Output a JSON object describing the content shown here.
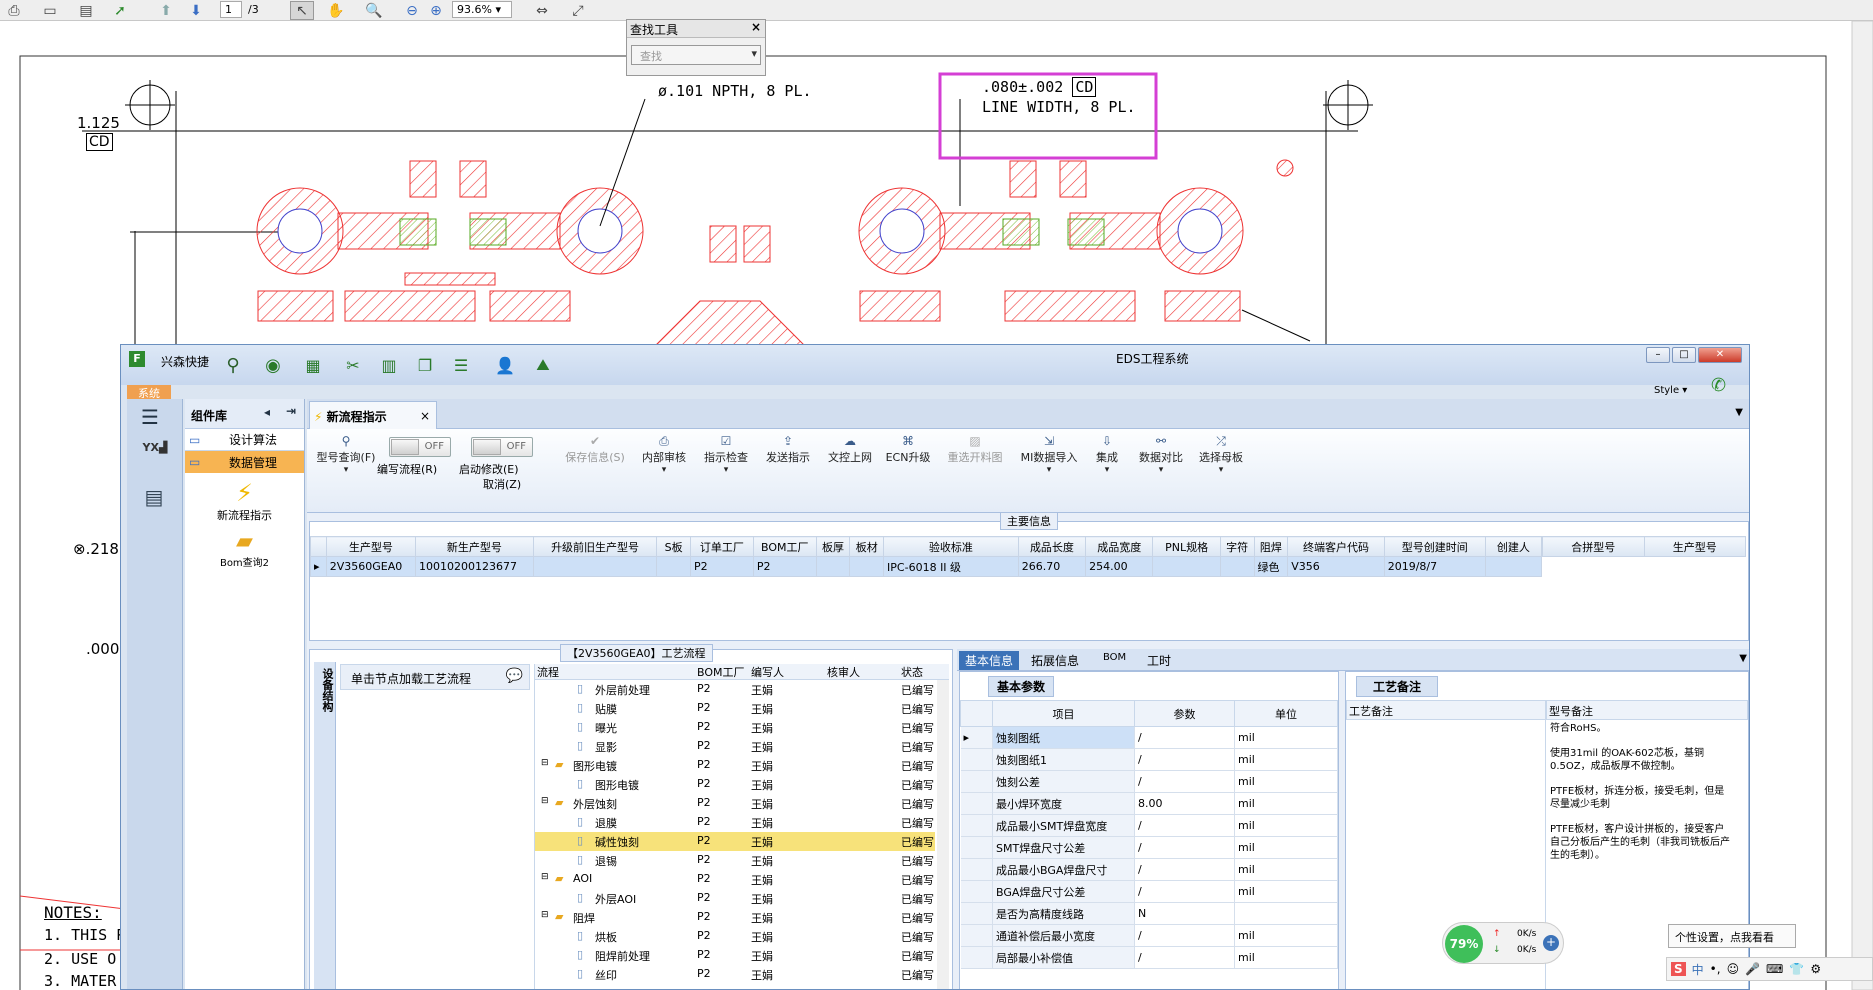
{
  "pdf": {
    "page_current": "1",
    "page_total": "/3",
    "zoom": "93.6%",
    "find_title": "查找工具",
    "find_placeholder": "查找",
    "drawing": {
      "npth": "ø.101 NPTH, 8 PL.",
      "linewidth_1": ".080±.002",
      "linewidth_cd": "CD",
      "linewidth_2": "LINE WIDTH, 8 PL.",
      "dim_1125": "1.125",
      "cd_left": "CD",
      "dim_218": "⊗.218",
      "dim_000": ".000",
      "notes": "NOTES:",
      "note1": "1. THIS P",
      "note2": "2. USE O",
      "note3": "3. MATER"
    }
  },
  "eds": {
    "app_name": "兴森快捷",
    "title": "EDS工程系统",
    "style_label": "Style",
    "system_tab": "系统",
    "library_title": "组件库",
    "library_items": [
      "设计算法",
      "数据管理"
    ],
    "new_process_label": "新流程指示",
    "bom_query_label": "Bom查询2",
    "doc_tab": "新流程指示",
    "ribbon": {
      "type_query": "型号查询(F)",
      "write_flow": "编写流程(R)",
      "start_edit": "启动修改(E)",
      "cancel": "取消(Z)",
      "off1": "OFF",
      "off2": "OFF",
      "save_info": "保存信息(S)",
      "internal_review": "内部审核",
      "instruction_check": "指示检查",
      "send_instruction": "发送指示",
      "doc_upload": "文控上网",
      "ecn_upgrade": "ECN升级",
      "reselect_drawing": "重选开料图",
      "mi_import": "MI数据导入",
      "integrate": "集成",
      "data_compare": "数据对比",
      "select_mother": "选择母板"
    },
    "main_info": {
      "title": "主要信息",
      "headers": [
        "生产型号",
        "新生产型号",
        "升级前旧生产型号",
        "S板",
        "订单工厂",
        "BOM工厂",
        "板厚",
        "板材",
        "验收标准",
        "成品长度",
        "成品宽度",
        "PNL规格",
        "字符",
        "阻焊",
        "终端客户代码",
        "型号创建时间",
        "创建人"
      ],
      "row": [
        "2V3560GEA0",
        "10010200123677",
        "",
        "",
        "P2",
        "P2",
        "",
        "",
        "IPC-6018 II 级",
        "266.70",
        "254.00",
        "",
        "",
        "绿色",
        "V356",
        "2019/8/7",
        ""
      ],
      "side_headers": [
        "合拼型号",
        "生产型号"
      ]
    },
    "process": {
      "title": "【2V3560GEA0】工艺流程",
      "vtab": "设备结构",
      "hint": "单击节点加载工艺流程",
      "headers": [
        "流程",
        "BOM工厂",
        "编写人",
        "核审人",
        "状态"
      ],
      "rows": [
        {
          "name": "外层前处理",
          "level": 2,
          "factory": "P2",
          "author": "王娟",
          "status": "已编写"
        },
        {
          "name": "贴膜",
          "level": 2,
          "factory": "P2",
          "author": "王娟",
          "status": "已编写"
        },
        {
          "name": "曝光",
          "level": 2,
          "factory": "P2",
          "author": "王娟",
          "status": "已编写"
        },
        {
          "name": "显影",
          "level": 2,
          "factory": "P2",
          "author": "王娟",
          "status": "已编写"
        },
        {
          "name": "图形电镀",
          "level": 1,
          "factory": "P2",
          "author": "王娟",
          "status": "已编写"
        },
        {
          "name": "图形电镀",
          "level": 2,
          "factory": "P2",
          "author": "王娟",
          "status": "已编写"
        },
        {
          "name": "外层蚀刻",
          "level": 1,
          "factory": "P2",
          "author": "王娟",
          "status": "已编写"
        },
        {
          "name": "退膜",
          "level": 2,
          "factory": "P2",
          "author": "王娟",
          "status": "已编写"
        },
        {
          "name": "碱性蚀刻",
          "level": 2,
          "factory": "P2",
          "author": "王娟",
          "status": "已编写",
          "selected": true
        },
        {
          "name": "退锡",
          "level": 2,
          "factory": "P2",
          "author": "王娟",
          "status": "已编写"
        },
        {
          "name": "AOI",
          "level": 1,
          "factory": "P2",
          "author": "王娟",
          "status": "已编写"
        },
        {
          "name": "外层AOI",
          "level": 2,
          "factory": "P2",
          "author": "王娟",
          "status": "已编写"
        },
        {
          "name": "阻焊",
          "level": 1,
          "factory": "P2",
          "author": "王娟",
          "status": "已编写"
        },
        {
          "name": "烘板",
          "level": 2,
          "factory": "P2",
          "author": "王娟",
          "status": "已编写"
        },
        {
          "name": "阻焊前处理",
          "level": 2,
          "factory": "P2",
          "author": "王娟",
          "status": "已编写"
        },
        {
          "name": "丝印",
          "level": 2,
          "factory": "P2",
          "author": "王娟",
          "status": "已编写"
        }
      ]
    },
    "detail_tabs": [
      "基本信息",
      "拓展信息",
      "BOM",
      "工时"
    ],
    "basic_params": {
      "title": "基本参数",
      "headers": [
        "项目",
        "参数",
        "单位"
      ],
      "rows": [
        [
          "蚀刻图纸",
          "/",
          "mil"
        ],
        [
          "蚀刻图纸1",
          "/",
          "mil"
        ],
        [
          "蚀刻公差",
          "/",
          "mil"
        ],
        [
          "最小焊环宽度",
          "8.00",
          "mil"
        ],
        [
          "成品最小SMT焊盘宽度",
          "/",
          "mil"
        ],
        [
          "SMT焊盘尺寸公差",
          "/",
          "mil"
        ],
        [
          "成品最小BGA焊盘尺寸",
          "/",
          "mil"
        ],
        [
          "BGA焊盘尺寸公差",
          "/",
          "mil"
        ],
        [
          "是否为高精度线路",
          "N",
          ""
        ],
        [
          "通道补偿后最小宽度",
          "/",
          "mil"
        ],
        [
          "局部最小补偿值",
          "/",
          "mil"
        ]
      ]
    },
    "process_notes": {
      "title": "工艺备注",
      "col1": "工艺备注",
      "col2": "型号备注",
      "notes": [
        "符合RoHS。",
        "使用31mil 的OAK-602芯板，基铜0.5OZ，成品板厚不做控制。",
        "PTFE板材，拆连分板，接受毛刺，但是尽量减少毛刺",
        "PTFE板材，客户设计拼板的，接受客户自己分板后产生的毛刺（非我司铣板后产生的毛刺）。"
      ]
    }
  },
  "tray": {
    "net_percent": "79%",
    "up_speed": "0K/s",
    "down_speed": "0K/s",
    "tooltip": "个性设置，点我看看",
    "ime_lang": "中"
  }
}
